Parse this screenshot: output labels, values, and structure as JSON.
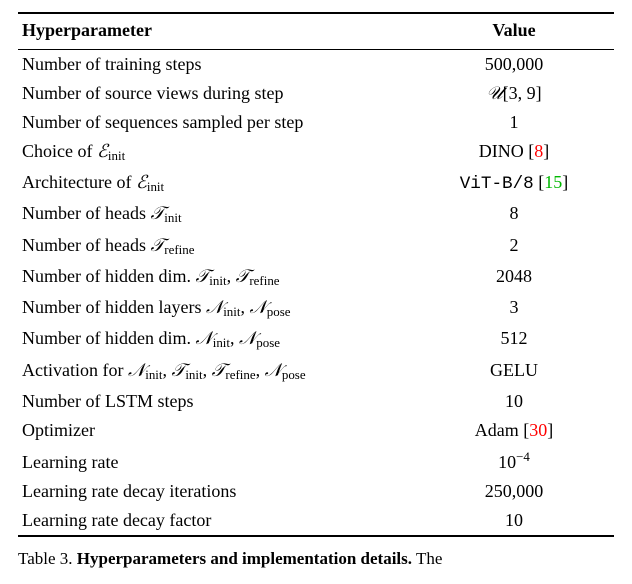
{
  "table": {
    "header": {
      "left": "Hyperparameter",
      "right": "Value"
    },
    "rows": [
      {
        "label_plain": "Number of training steps",
        "value_plain": "500,000"
      },
      {
        "label_plain": "Number of source views during step",
        "value_html": "<span class='math'>𝒰</span>[3, 9]"
      },
      {
        "label_plain": "Number of sequences sampled per step",
        "value_plain": "1"
      },
      {
        "label_html": "Choice of <span class='math'>ℰ</span><span class='sub'>init</span>",
        "value_html": "DINO [<a class='cite red' href='#'>8</a>]"
      },
      {
        "label_html": "Architecture of <span class='math'>ℰ</span><span class='sub'>init</span>",
        "value_html": "<span class='mono'>ViT-B/8</span> [<a class='cite green' href='#'>15</a>]"
      },
      {
        "label_html": "Number of heads <span class='math'>𝒯</span><span class='sub'>init</span>",
        "value_plain": "8"
      },
      {
        "label_html": "Number of heads <span class='math'>𝒯</span><span class='sub'>refine</span>",
        "value_plain": "2"
      },
      {
        "label_html": "Number of hidden dim. <span class='math'>𝒯</span><span class='sub'>init</span>, <span class='math'>𝒯</span><span class='sub'>refine</span>",
        "value_plain": "2048"
      },
      {
        "label_html": "Number of hidden layers <span class='math'>𝒩</span><span class='sub'>init</span>, <span class='math'>𝒩</span><span class='sub'>pose</span>",
        "value_plain": "3"
      },
      {
        "label_html": "Number of hidden dim. <span class='math'>𝒩</span><span class='sub'>init</span>, <span class='math'>𝒩</span><span class='sub'>pose</span>",
        "value_plain": "512"
      },
      {
        "label_html": "Activation for <span class='math'>𝒩</span><span class='sub'>init</span>, <span class='math'>𝒯</span><span class='sub'>init</span>, <span class='math'>𝒯</span><span class='sub'>refine</span>, <span class='math'>𝒩</span><span class='sub'>pose</span>",
        "value_plain": "GELU"
      },
      {
        "label_plain": "Number of LSTM steps",
        "value_plain": "10"
      },
      {
        "label_plain": "Optimizer",
        "value_html": "Adam [<a class='cite red' href='#'>30</a>]"
      },
      {
        "label_plain": "Learning rate",
        "value_html": "10<sup class='exp'>−4</sup>"
      },
      {
        "label_plain": "Learning rate decay iterations",
        "value_plain": "250,000"
      },
      {
        "label_plain": "Learning rate decay factor",
        "value_plain": "10"
      }
    ]
  },
  "caption": {
    "label": "Table 3.",
    "bold": "Hyperparameters and implementation details.",
    "trail": " The "
  }
}
